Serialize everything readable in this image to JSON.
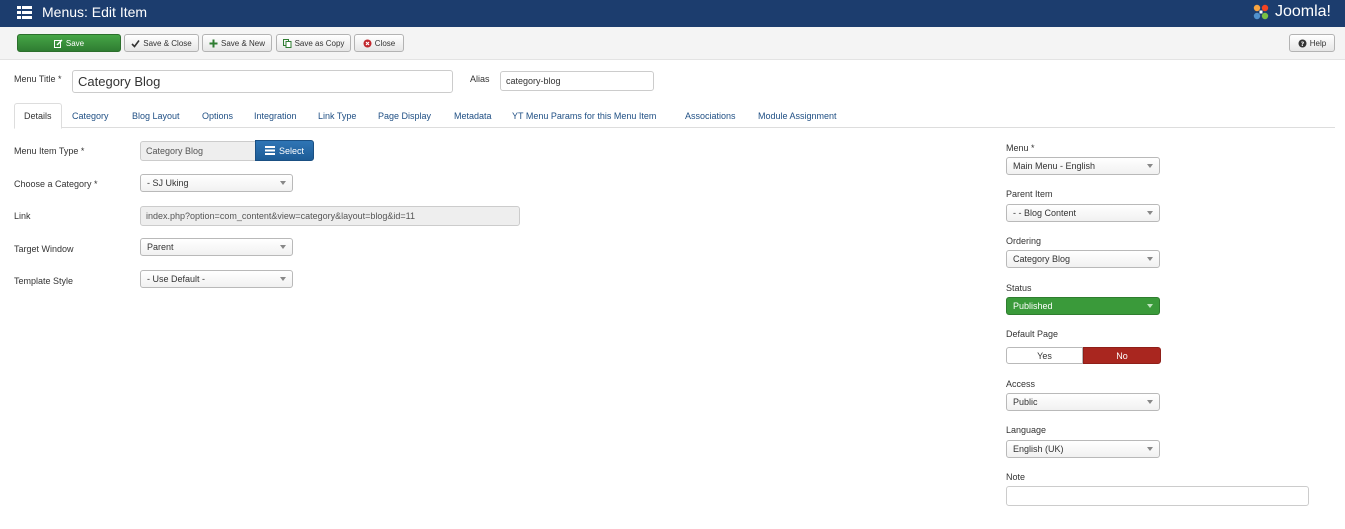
{
  "header": {
    "title": "Menus: Edit Item",
    "logo_text": "Joomla!"
  },
  "toolbar": {
    "save": "Save",
    "save_close": "Save & Close",
    "save_new": "Save & New",
    "save_copy": "Save as Copy",
    "close": "Close",
    "help": "Help"
  },
  "title_row": {
    "menu_title_label": "Menu Title *",
    "menu_title_value": "Category Blog",
    "alias_label": "Alias",
    "alias_value": "category-blog"
  },
  "tabs": [
    "Details",
    "Category",
    "Blog Layout",
    "Options",
    "Integration",
    "Link Type",
    "Page Display",
    "Metadata",
    "YT Menu Params for this Menu Item",
    "Associations",
    "Module Assignment"
  ],
  "details": {
    "menu_item_type_label": "Menu Item Type *",
    "menu_item_type_value": "Category Blog",
    "select_button": "Select",
    "category_label": "Choose a Category *",
    "category_value": "- SJ Uking",
    "link_label": "Link",
    "link_value": "index.php?option=com_content&view=category&layout=blog&id=11",
    "target_label": "Target Window",
    "target_value": "Parent",
    "template_label": "Template Style",
    "template_value": "- Use Default -"
  },
  "sidebar": {
    "menu_label": "Menu *",
    "menu_value": "Main Menu - English",
    "parent_label": "Parent Item",
    "parent_value": "- - Blog Content",
    "ordering_label": "Ordering",
    "ordering_value": "Category Blog",
    "status_label": "Status",
    "status_value": "Published",
    "default_label": "Default Page",
    "default_yes": "Yes",
    "default_no": "No",
    "access_label": "Access",
    "access_value": "Public",
    "language_label": "Language",
    "language_value": "English (UK)",
    "note_label": "Note",
    "note_value": ""
  },
  "colors": {
    "header_bg": "#1c3d6e",
    "save_green": "#2f7d32",
    "published_green": "#3a9a3a",
    "no_red": "#a9261f",
    "select_blue": "#1d5c96",
    "tab_link": "#1f4f84"
  }
}
